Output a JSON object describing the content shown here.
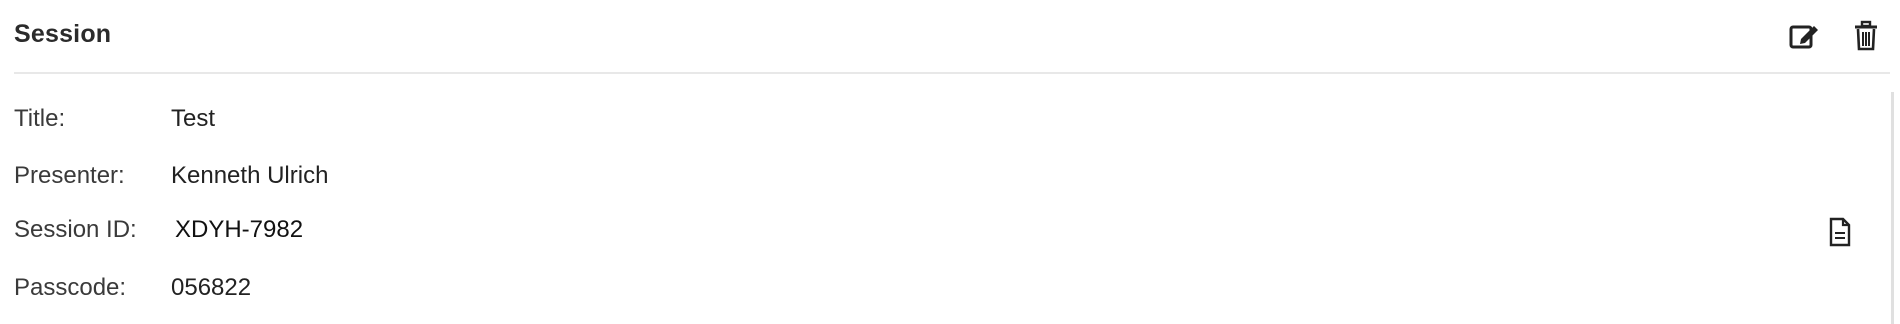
{
  "header": {
    "title": "Session",
    "edit_icon": "edit-icon",
    "delete_icon": "trash-icon"
  },
  "details": {
    "title_label": "Title:",
    "title_value": "Test",
    "presenter_label": "Presenter:",
    "presenter_value": "Kenneth Ulrich",
    "session_id_label": "Session ID:",
    "session_id_value": "XDYH-7982",
    "passcode_label": "Passcode:",
    "passcode_value": "056822",
    "document_icon": "document-icon"
  },
  "colors": {
    "text": "#222222",
    "divider": "#e8e8e8"
  }
}
